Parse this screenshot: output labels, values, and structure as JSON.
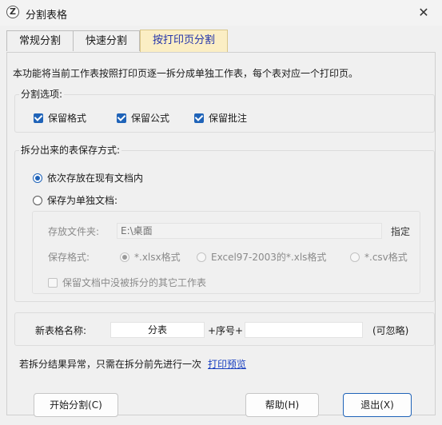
{
  "window": {
    "title": "分割表格",
    "close_glyph": "✕"
  },
  "tabs": [
    {
      "label": "常规分割",
      "active": false
    },
    {
      "label": "快速分割",
      "active": false
    },
    {
      "label": "按打印页分割",
      "active": true
    }
  ],
  "description": "本功能将当前工作表按照打印页逐一拆分成单独工作表，每个表对应一个打印页。",
  "split_options": {
    "label": "分割选项:",
    "items": [
      {
        "label": "保留格式",
        "checked": true
      },
      {
        "label": "保留公式",
        "checked": true
      },
      {
        "label": "保留批注",
        "checked": true
      }
    ]
  },
  "save_mode": {
    "label": "拆分出来的表保存方式:",
    "options": [
      {
        "label": "依次存放在现有文档内",
        "selected": true
      },
      {
        "label": "保存为单独文档:",
        "selected": false
      }
    ],
    "folder_label": "存放文件夹:",
    "folder_value": "E:\\桌面",
    "browse_label": "指定",
    "format_label": "保存格式:",
    "formats": [
      {
        "label": "*.xlsx格式",
        "selected": true
      },
      {
        "label": "Excel97-2003的*.xls格式",
        "selected": false
      },
      {
        "label": "*.csv格式",
        "selected": false
      }
    ],
    "keep_other_label": "保留文档中没被拆分的其它工作表",
    "keep_other_checked": false
  },
  "naming": {
    "label": "新表格名称:",
    "prefix_value": "分表",
    "seq_label": "+序号+",
    "suffix_value": "",
    "optional_label": "(可忽略)"
  },
  "hint": {
    "text": "若拆分结果异常，只需在拆分前先进行一次",
    "link": "打印预览"
  },
  "buttons": {
    "start": "开始分割(C)",
    "help": "帮助(H)",
    "exit": "退出(X)"
  },
  "colors": {
    "accent": "#1f63b8",
    "active_tab": "#fbeec4",
    "link": "#1a40c0"
  }
}
